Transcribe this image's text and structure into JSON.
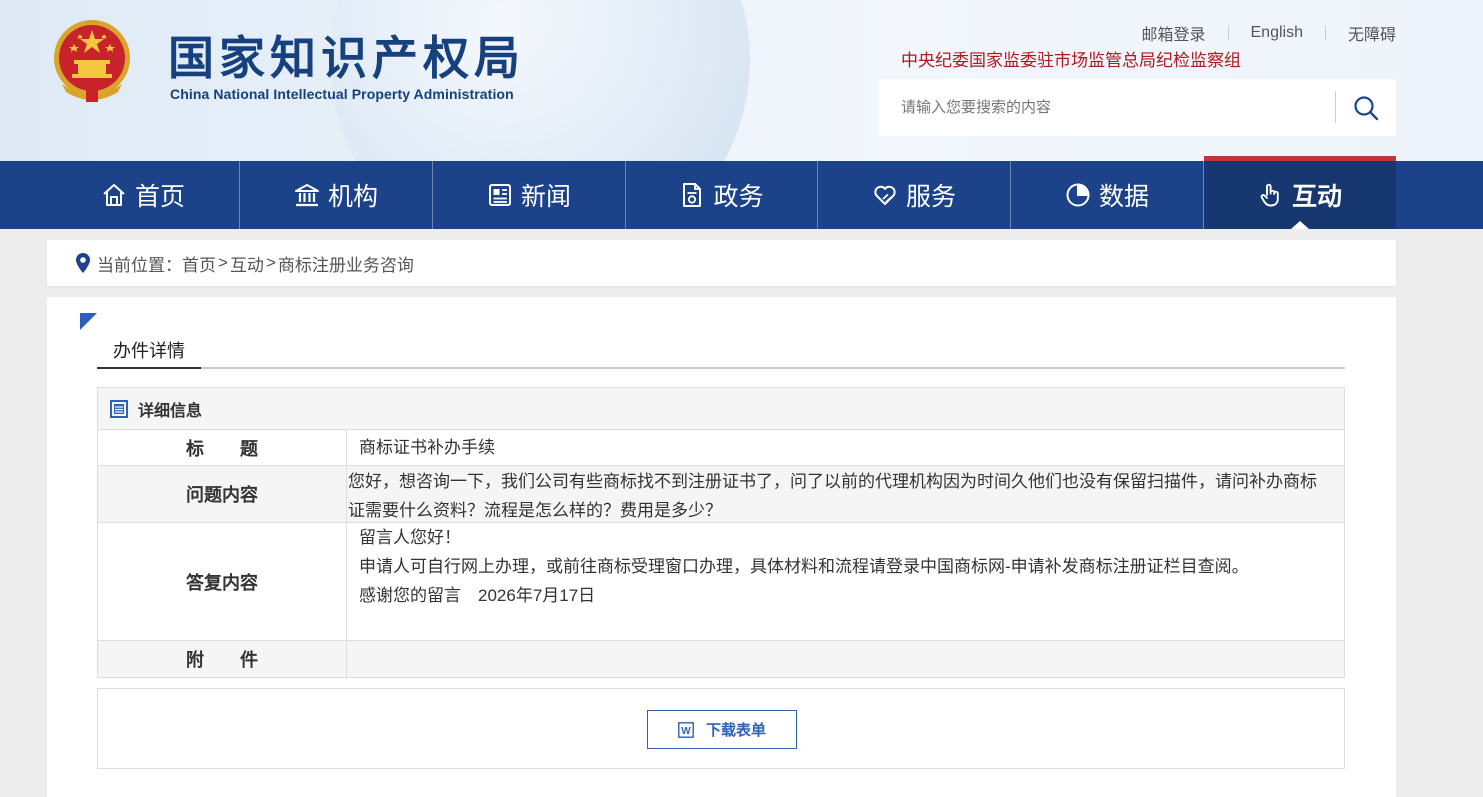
{
  "header": {
    "logo_cn": "国家知识产权局",
    "logo_en": "China National Intellectual Property Administration",
    "top_links": [
      "邮箱登录",
      "English",
      "无障碍"
    ],
    "supervision_text": "中央纪委国家监委驻市场监管总局纪检监察组",
    "search_placeholder": "请输入您要搜索的内容",
    "brand_color": "#16407e",
    "accent_red": "#b0181e"
  },
  "nav": {
    "bg_color": "#1c4389",
    "items": [
      {
        "label": "首页",
        "icon": "home-icon"
      },
      {
        "label": "机构",
        "icon": "institution-icon"
      },
      {
        "label": "新闻",
        "icon": "news-icon"
      },
      {
        "label": "政务",
        "icon": "document-icon"
      },
      {
        "label": "服务",
        "icon": "heart-hand-icon"
      },
      {
        "label": "数据",
        "icon": "pie-chart-icon"
      },
      {
        "label": "互动",
        "icon": "hand-pointer-icon",
        "active": true
      }
    ]
  },
  "breadcrumb": {
    "prefix": "当前位置：",
    "items": [
      "首页",
      "互动",
      "商标注册业务咨询"
    ],
    "separator": ">"
  },
  "main": {
    "tab_label": "办件详情",
    "detail_header": "详细信息",
    "rows": {
      "title_key": "标　　题",
      "title_value": "商标证书补办手续",
      "question_key": "问题内容",
      "question_value": " 您好，想咨询一下，我们公司有些商标找不到注册证书了，问了以前的代理机构因为时间久他们也没有保留扫描件，请问补办商标证需要什么资料？流程是怎么样的？费用是多少？",
      "reply_key": "答复内容",
      "reply_line1": "留言人您好！",
      "reply_line2": "申请人可自行网上办理，或前往商标受理窗口办理，具体材料和流程请登录中国商标网-申请补发商标注册证栏目查阅。",
      "reply_line3": "感谢您的留言　2026年7月17日",
      "attachment_key": "附　　件",
      "attachment_value": ""
    },
    "download_label": "下载表单"
  }
}
